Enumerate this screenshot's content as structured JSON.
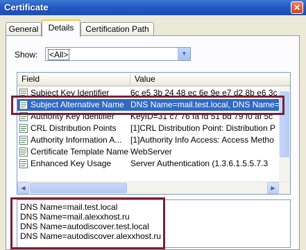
{
  "window": {
    "title": "Certificate",
    "close_glyph": "✕"
  },
  "tabs": [
    {
      "label": "General",
      "active": false
    },
    {
      "label": "Details",
      "active": true
    },
    {
      "label": "Certification Path",
      "active": false
    }
  ],
  "show": {
    "label": "Show:",
    "value": "<All>"
  },
  "list": {
    "columns": {
      "field": "Field",
      "value": "Value"
    },
    "rows": [
      {
        "field": "Subject Key Identifier",
        "value": "6c e5 3b 24 48 ec 6e 9e e7 d2 8b e6 3c"
      },
      {
        "field": "Subject Alternative Name",
        "value": "DNS Name=mail.test.local, DNS Name=mail.alexxhost.ru",
        "selected": true
      },
      {
        "field": "Authority Key Identifier",
        "value": "KeyID=31 c7 76 fa fd 51 bd 79 f0 af 5c"
      },
      {
        "field": "CRL Distribution Points",
        "value": "[1]CRL Distribution Point: Distribution P"
      },
      {
        "field": "Authority Information A...",
        "value": "[1]Authority Info Access: Access Metho"
      },
      {
        "field": "Certificate Template Name",
        "value": "WebServer"
      },
      {
        "field": "Enhanced Key Usage",
        "value": "Server Authentication (1.3.6.1.5.5.7.3"
      }
    ]
  },
  "detail": {
    "lines": [
      "DNS Name=mail.test.local",
      "DNS Name=mail.alexxhost.ru",
      "DNS Name=autodiscover.test.local",
      "DNS Name=autodiscover.alexxhost.ru"
    ]
  },
  "colors": {
    "titlebar": "#2359c4",
    "selection": "#316ac5",
    "highlight_box": "#7a1f35"
  }
}
